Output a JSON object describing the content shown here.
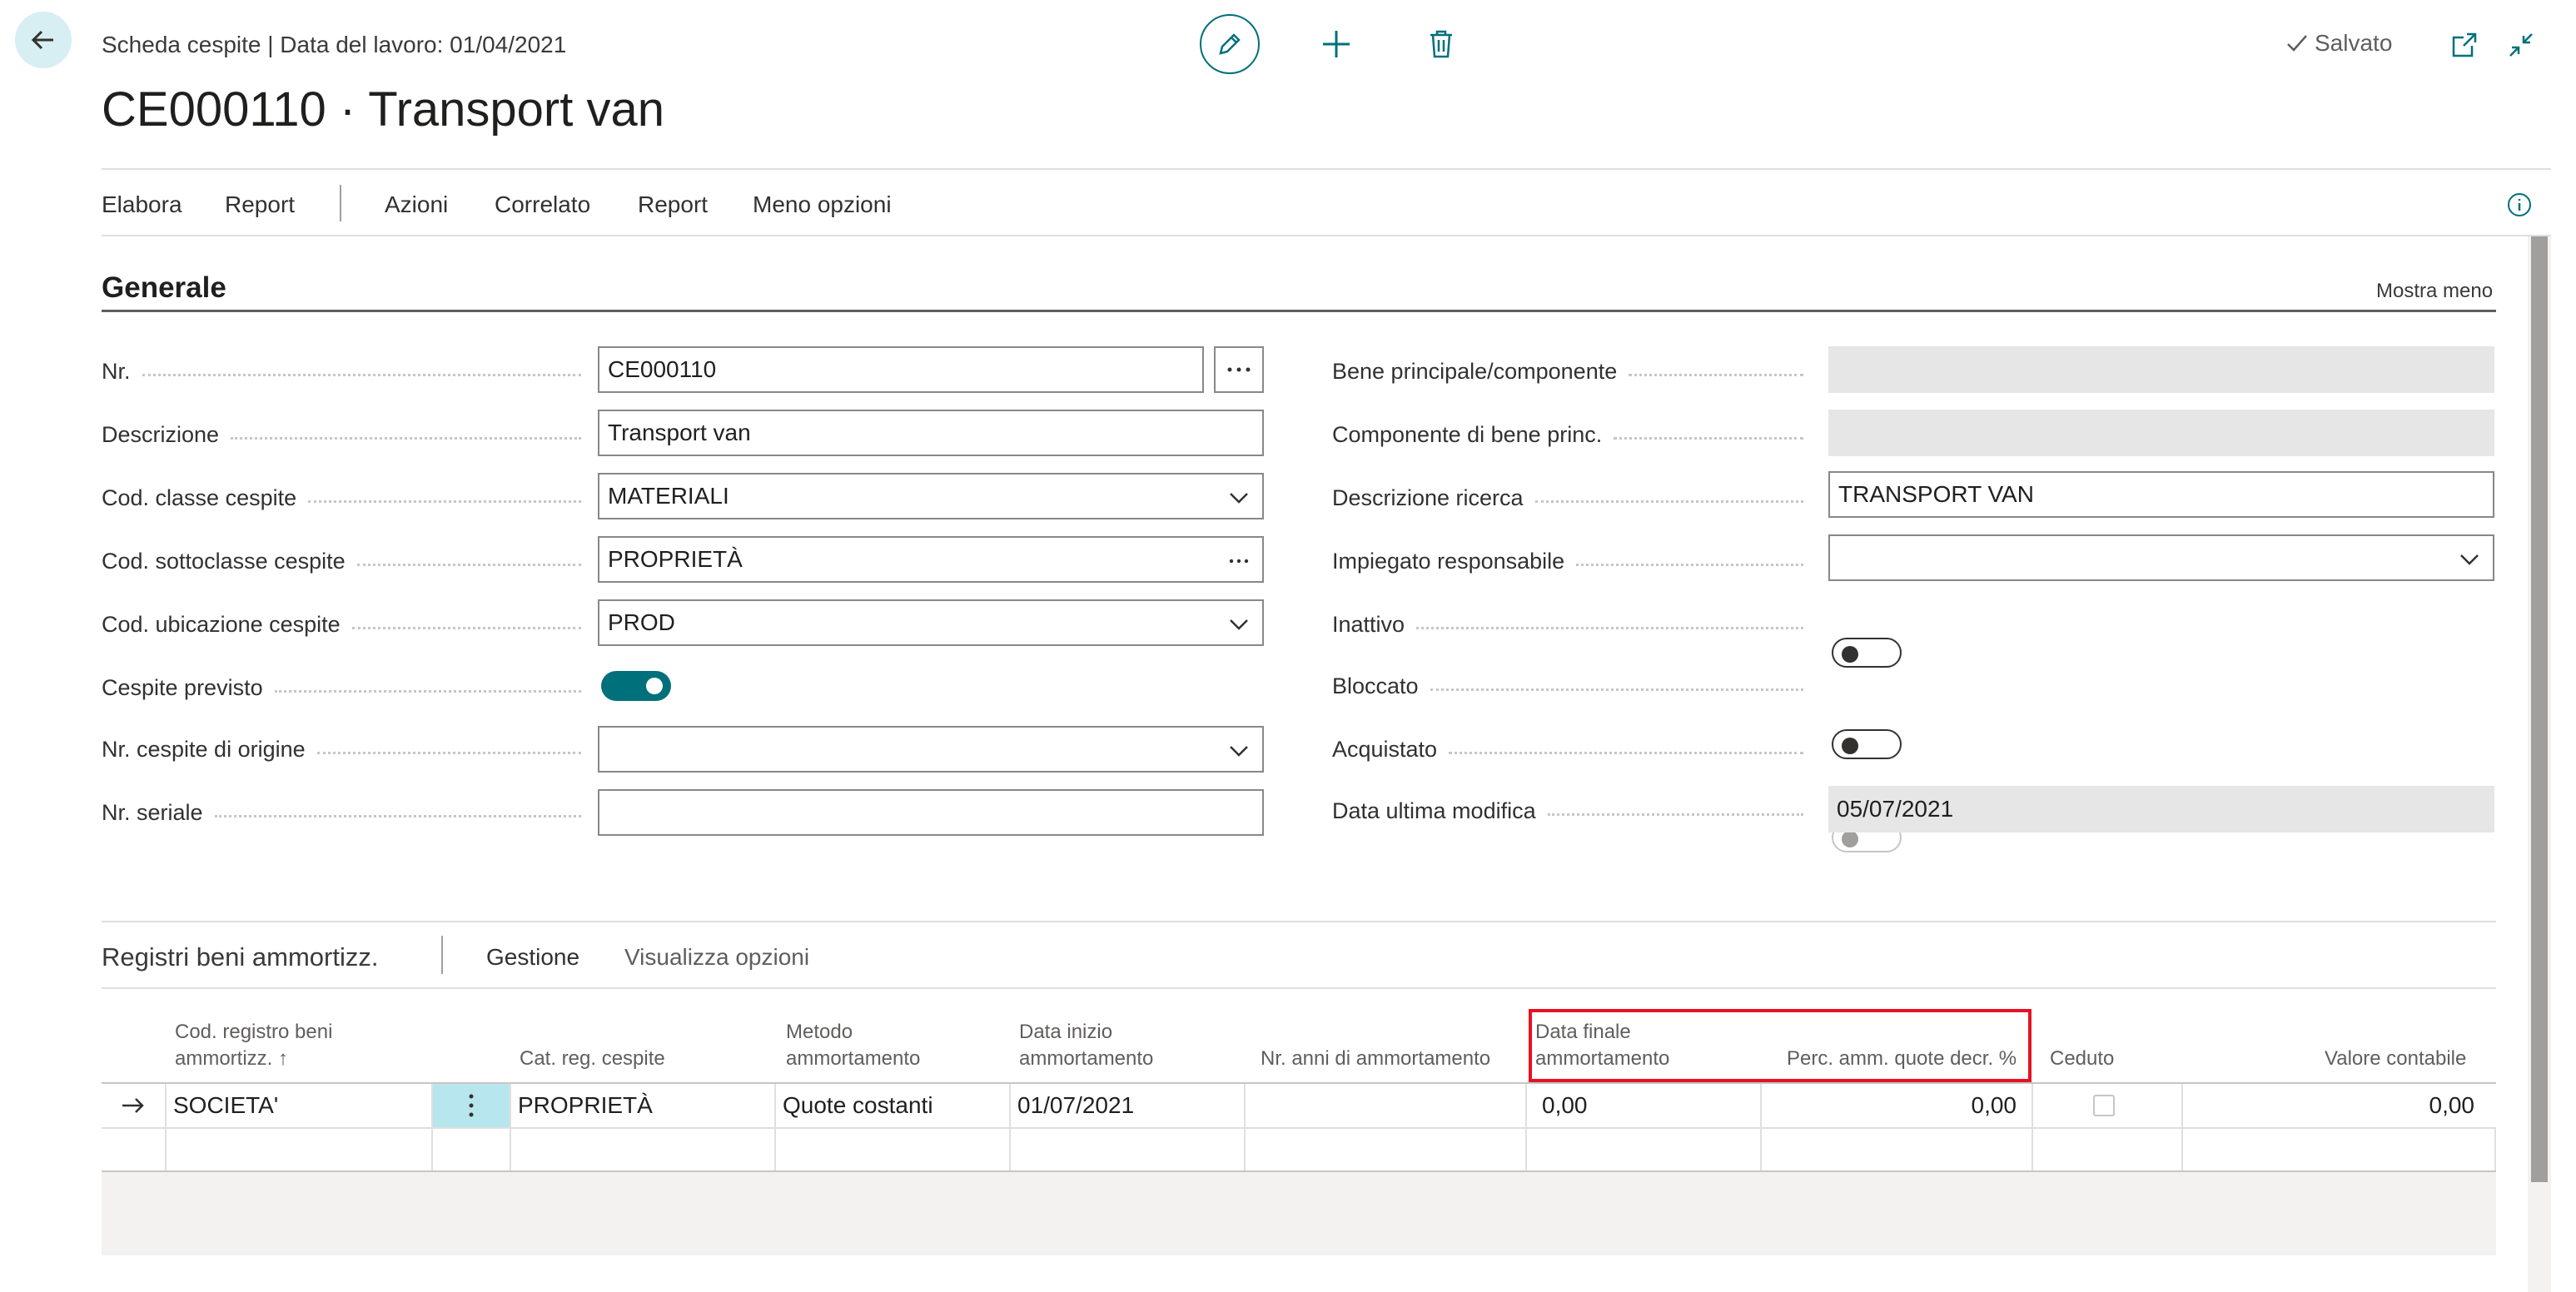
{
  "header": {
    "breadcrumb": "Scheda cespite | Data del lavoro: 01/04/2021",
    "title": "CE000110 · Transport van",
    "saved_status": "Salvato"
  },
  "action_menu": [
    "Elabora",
    "Report",
    "Azioni",
    "Correlato",
    "Report",
    "Meno opzioni"
  ],
  "general": {
    "section_title": "Generale",
    "show_less": "Mostra meno",
    "left_fields": [
      {
        "label": "Nr.",
        "value": "CE000110",
        "type": "text-assist"
      },
      {
        "label": "Descrizione",
        "value": "Transport van",
        "type": "text"
      },
      {
        "label": "Cod. classe cespite",
        "value": "MATERIALI",
        "type": "dropdown"
      },
      {
        "label": "Cod. sottoclasse cespite",
        "value": "PROPRIETÀ",
        "type": "lookup"
      },
      {
        "label": "Cod. ubicazione cespite",
        "value": "PROD",
        "type": "dropdown"
      },
      {
        "label": "Cespite previsto",
        "value": "on",
        "type": "toggle"
      },
      {
        "label": "Nr. cespite di origine",
        "value": "",
        "type": "dropdown"
      },
      {
        "label": "Nr. seriale",
        "value": "",
        "type": "text"
      }
    ],
    "right_fields": [
      {
        "label": "Bene principale/componente",
        "value": "",
        "type": "readonly"
      },
      {
        "label": "Componente di bene princ.",
        "value": "",
        "type": "readonly"
      },
      {
        "label": "Descrizione ricerca",
        "value": "TRANSPORT VAN",
        "type": "text"
      },
      {
        "label": "Impiegato responsabile",
        "value": "",
        "type": "dropdown"
      },
      {
        "label": "Inattivo",
        "value": "off",
        "type": "toggle"
      },
      {
        "label": "Bloccato",
        "value": "off",
        "type": "toggle"
      },
      {
        "label": "Acquistato",
        "value": "disabled",
        "type": "toggle"
      },
      {
        "label": "Data ultima modifica",
        "value": "05/07/2021",
        "type": "readonly"
      }
    ]
  },
  "depreciation": {
    "section_title": "Registri beni ammortizz.",
    "actions": [
      "Gestione",
      "Visualizza opzioni"
    ],
    "columns": {
      "book_code_line1": "Cod. registro beni",
      "book_code_line2": "ammortizz. ↑",
      "posting_group": "Cat. reg. cespite",
      "method_line1": "Metodo",
      "method_line2": "ammortamento",
      "start_date_line1": "Data inizio",
      "start_date_line2": "ammortamento",
      "years": "Nr. anni di ammortamento",
      "end_date_line1": "Data finale",
      "end_date_line2": "ammortamento",
      "declining_pct": "Perc. amm. quote decr. %",
      "disposed": "Ceduto",
      "book_value": "Valore contabile"
    },
    "row": {
      "book_code": "SOCIETA'",
      "posting_group": "PROPRIETÀ",
      "method": "Quote costanti",
      "start_date": "01/07/2021",
      "years": "",
      "end_date": "0,00",
      "declining_pct": "0,00",
      "book_value": "0,00"
    }
  },
  "colors": {
    "accent": "#00707a",
    "highlight_box": "#e81123",
    "selected_cell": "#b8e6ee"
  },
  "icons": [
    "back-arrow-icon",
    "edit-pencil-icon",
    "plus-icon",
    "trash-icon",
    "checkmark-icon",
    "open-new-window-icon",
    "collapse-icon",
    "info-icon",
    "ellipsis-icon",
    "chevron-down-icon",
    "row-arrow-icon",
    "row-menu-icon"
  ]
}
